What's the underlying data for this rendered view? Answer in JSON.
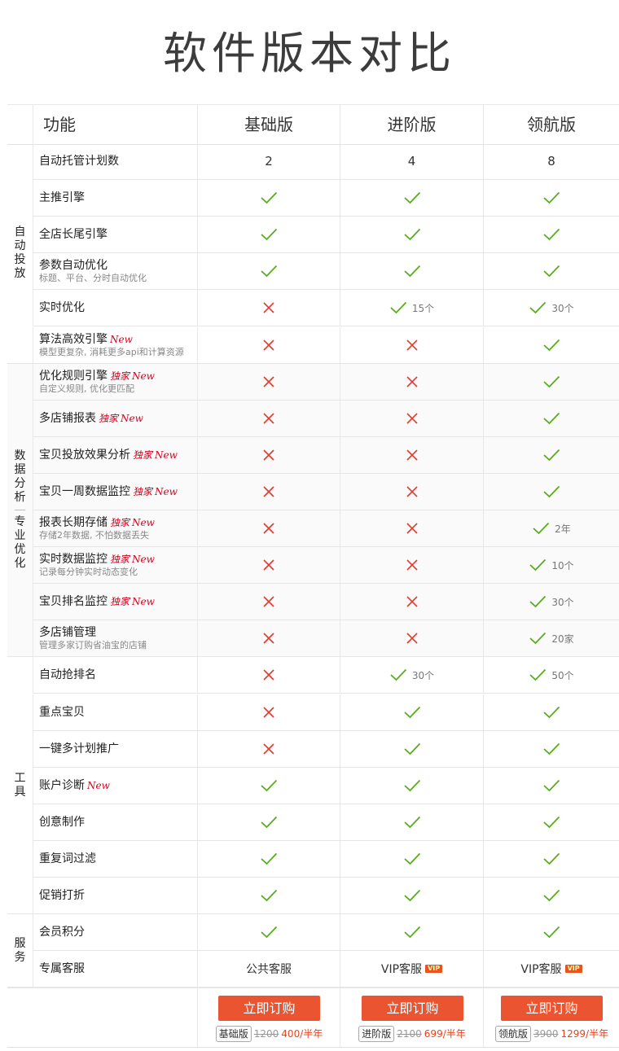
{
  "title": "软件版本对比",
  "header": {
    "feature_label": "功能",
    "tiers": [
      "基础版",
      "进阶版",
      "领航版"
    ]
  },
  "categories": [
    {
      "label": "自动投放",
      "label2": ""
    },
    {
      "label": "数据分析",
      "label2": "专业优化"
    },
    {
      "label": "工具",
      "label2": ""
    },
    {
      "label": "服务",
      "label2": ""
    }
  ],
  "rows": [
    {
      "name": "自动托管计划数",
      "tags": [],
      "sub": "",
      "cells": [
        {
          "type": "text",
          "text": "2"
        },
        {
          "type": "text",
          "text": "4"
        },
        {
          "type": "text",
          "text": "8"
        }
      ]
    },
    {
      "name": "主推引擎",
      "tags": [],
      "sub": "",
      "cells": [
        {
          "type": "yes"
        },
        {
          "type": "yes"
        },
        {
          "type": "yes"
        }
      ]
    },
    {
      "name": "全店长尾引擎",
      "tags": [],
      "sub": "",
      "cells": [
        {
          "type": "yes"
        },
        {
          "type": "yes"
        },
        {
          "type": "yes"
        }
      ]
    },
    {
      "name": "参数自动优化",
      "tags": [],
      "sub": "标题、平台、分时自动优化",
      "cells": [
        {
          "type": "yes"
        },
        {
          "type": "yes"
        },
        {
          "type": "yes"
        }
      ]
    },
    {
      "name": "实时优化",
      "tags": [],
      "sub": "",
      "cells": [
        {
          "type": "no"
        },
        {
          "type": "yes",
          "note": "15个"
        },
        {
          "type": "yes",
          "note": "30个"
        }
      ]
    },
    {
      "name": "算法高效引擎",
      "tags": [
        "New"
      ],
      "sub": "模型更复杂, 消耗更多api和计算资源",
      "cells": [
        {
          "type": "no"
        },
        {
          "type": "no"
        },
        {
          "type": "yes"
        }
      ]
    },
    {
      "name": "优化规则引擎",
      "tags": [
        "独家",
        "New"
      ],
      "sub": "自定义规则, 优化更匹配",
      "cells": [
        {
          "type": "no"
        },
        {
          "type": "no"
        },
        {
          "type": "yes"
        }
      ]
    },
    {
      "name": "多店铺报表",
      "tags": [
        "独家",
        "New"
      ],
      "sub": "",
      "cells": [
        {
          "type": "no"
        },
        {
          "type": "no"
        },
        {
          "type": "yes"
        }
      ]
    },
    {
      "name": "宝贝投放效果分析",
      "tags": [
        "独家",
        "New"
      ],
      "sub": "",
      "cells": [
        {
          "type": "no"
        },
        {
          "type": "no"
        },
        {
          "type": "yes"
        }
      ]
    },
    {
      "name": "宝贝一周数据监控",
      "tags": [
        "独家",
        "New"
      ],
      "sub": "",
      "cells": [
        {
          "type": "no"
        },
        {
          "type": "no"
        },
        {
          "type": "yes"
        }
      ]
    },
    {
      "name": "报表长期存储",
      "tags": [
        "独家",
        "New"
      ],
      "sub": "存储2年数据, 不怕数据丢失",
      "cells": [
        {
          "type": "no"
        },
        {
          "type": "no"
        },
        {
          "type": "yes",
          "note": "2年"
        }
      ]
    },
    {
      "name": "实时数据监控",
      "tags": [
        "独家",
        "New"
      ],
      "sub": "记录每分钟实时动态变化",
      "cells": [
        {
          "type": "no"
        },
        {
          "type": "no"
        },
        {
          "type": "yes",
          "note": "10个"
        }
      ]
    },
    {
      "name": "宝贝排名监控",
      "tags": [
        "独家",
        "New"
      ],
      "sub": "",
      "cells": [
        {
          "type": "no"
        },
        {
          "type": "no"
        },
        {
          "type": "yes",
          "note": "30个"
        }
      ]
    },
    {
      "name": "多店铺管理",
      "tags": [],
      "sub": "管理多家订购省油宝的店铺",
      "cells": [
        {
          "type": "no"
        },
        {
          "type": "no"
        },
        {
          "type": "yes",
          "note": "20家"
        }
      ]
    },
    {
      "name": "自动抢排名",
      "tags": [],
      "sub": "",
      "cells": [
        {
          "type": "no"
        },
        {
          "type": "yes",
          "note": "30个"
        },
        {
          "type": "yes",
          "note": "50个"
        }
      ]
    },
    {
      "name": "重点宝贝",
      "tags": [],
      "sub": "",
      "cells": [
        {
          "type": "no"
        },
        {
          "type": "yes"
        },
        {
          "type": "yes"
        }
      ]
    },
    {
      "name": "一键多计划推广",
      "tags": [],
      "sub": "",
      "cells": [
        {
          "type": "no"
        },
        {
          "type": "yes"
        },
        {
          "type": "yes"
        }
      ]
    },
    {
      "name": "账户诊断",
      "tags": [
        "New"
      ],
      "sub": "",
      "cells": [
        {
          "type": "yes"
        },
        {
          "type": "yes"
        },
        {
          "type": "yes"
        }
      ]
    },
    {
      "name": "创意制作",
      "tags": [],
      "sub": "",
      "cells": [
        {
          "type": "yes"
        },
        {
          "type": "yes"
        },
        {
          "type": "yes"
        }
      ]
    },
    {
      "name": "重复词过滤",
      "tags": [],
      "sub": "",
      "cells": [
        {
          "type": "yes"
        },
        {
          "type": "yes"
        },
        {
          "type": "yes"
        }
      ]
    },
    {
      "name": "促销打折",
      "tags": [],
      "sub": "",
      "cells": [
        {
          "type": "yes"
        },
        {
          "type": "yes"
        },
        {
          "type": "yes"
        }
      ]
    },
    {
      "name": "会员积分",
      "tags": [],
      "sub": "",
      "cells": [
        {
          "type": "yes"
        },
        {
          "type": "yes"
        },
        {
          "type": "yes"
        }
      ]
    },
    {
      "name": "专属客服",
      "tags": [],
      "sub": "",
      "cells": [
        {
          "type": "text",
          "text": "公共客服"
        },
        {
          "type": "text",
          "text": "VIP客服",
          "vip": "VIP"
        },
        {
          "type": "text",
          "text": "VIP客服",
          "vip": "VIP"
        }
      ]
    }
  ],
  "purchase": {
    "button_label": "立即订购",
    "plans": [
      {
        "name": "基础版",
        "old_price": "1200",
        "new_price": "400/半年"
      },
      {
        "name": "进阶版",
        "old_price": "2100",
        "new_price": "699/半年"
      },
      {
        "name": "领航版",
        "old_price": "3900",
        "new_price": "1299/半年"
      }
    ]
  },
  "colors": {
    "check": "#58ad1c",
    "cross": "#e43a2c",
    "accent": "#ea5430",
    "tag": "#d6001c"
  },
  "icons": {
    "yes": "check-icon",
    "no": "cross-icon"
  }
}
